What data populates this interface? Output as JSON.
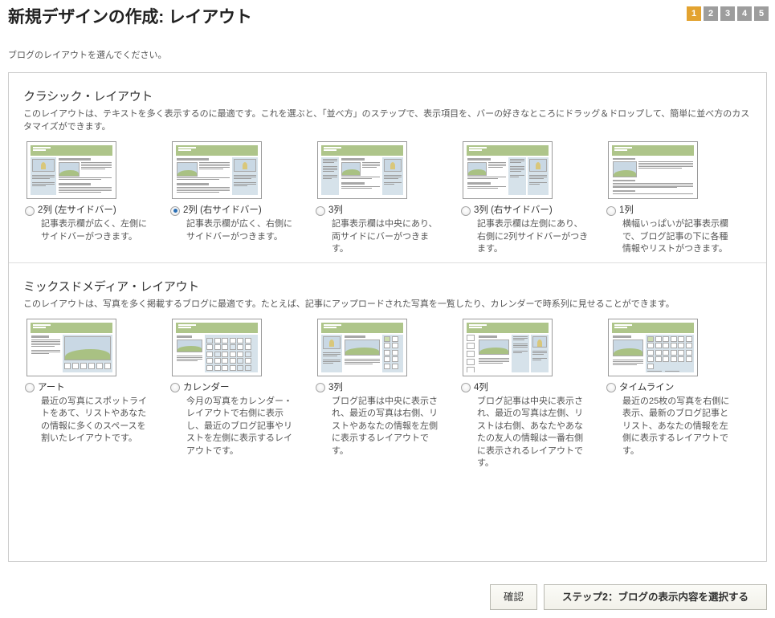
{
  "header": {
    "title": "新規デザインの作成: レイアウト",
    "subtitle": "ブログのレイアウトを選んでください。",
    "steps": [
      "1",
      "2",
      "3",
      "4",
      "5"
    ],
    "active_step": "1",
    "active_step_color": "#e3a330",
    "inactive_step_color": "#9d9d9d"
  },
  "sections": [
    {
      "title": "クラシック・レイアウト",
      "description": "このレイアウトは、テキストを多く表示するのに最適です。これを選ぶと、「並べ方」のステップで、表示項目を、バーの好きなところにドラッグ＆ドロップして、簡単に並べ方のカスタマイズができます。",
      "options": [
        {
          "label": "2列 (左サイドバー)",
          "description": "記事表示欄が広く、左側にサイドバーがつきます。",
          "selected": false,
          "thumb": "classic-left-sidebar"
        },
        {
          "label": "2列 (右サイドバー)",
          "description": "記事表示欄が広く、右側にサイドバーがつきます。",
          "selected": true,
          "thumb": "classic-right-sidebar"
        },
        {
          "label": "3列",
          "description": "記事表示欄は中央にあり、両サイドにバーがつきます。",
          "selected": false,
          "thumb": "classic-three-col"
        },
        {
          "label": "3列 (右サイドバー)",
          "description": "記事表示欄は左側にあり、右側に2列サイドバーがつきます。",
          "selected": false,
          "thumb": "classic-three-col-right"
        },
        {
          "label": "1列",
          "description": "横幅いっぱいが記事表示欄で、ブログ記事の下に各種情報やリストがつきます。",
          "selected": false,
          "thumb": "classic-one-col"
        }
      ]
    },
    {
      "title": "ミックスドメディア・レイアウト",
      "description": "このレイアウトは、写真を多く掲載するブログに最適です。たとえば、記事にアップロードされた写真を一覧したり、カレンダーで時系列に見せることができます。",
      "options": [
        {
          "label": "アート",
          "description": "最近の写真にスポットライトをあて、リストやあなたの情報に多くのスペースを割いたレイアウトです。",
          "selected": false,
          "thumb": "mixed-art"
        },
        {
          "label": "カレンダー",
          "description": "今月の写真をカレンダー・レイアウトで右側に表示し、最近のブログ記事やリストを左側に表示するレイアウトです。",
          "selected": false,
          "thumb": "mixed-calendar"
        },
        {
          "label": "3列",
          "description": "ブログ記事は中央に表示され、最近の写真は右側、リストやあなたの情報を左側に表示するレイアウトです。",
          "selected": false,
          "thumb": "mixed-three-col"
        },
        {
          "label": "4列",
          "description": "ブログ記事は中央に表示され、最近の写真は左側、リストは右側、あなたやあなたの友人の情報は一番右側に表示されるレイアウトです。",
          "selected": false,
          "thumb": "mixed-four-col"
        },
        {
          "label": "タイムライン",
          "description": "最近の25枚の写真を右側に表示、最新のブログ記事とリスト、あなたの情報を左側に表示するレイアウトです。",
          "selected": false,
          "thumb": "mixed-timeline"
        }
      ]
    }
  ],
  "footer": {
    "confirm_label": "確認",
    "next_label": "ステップ2：ブログの表示内容を選択する"
  },
  "colors": {
    "thumb_header_green": "#aec58a",
    "thumb_sidebar_blue": "#d6e2ea",
    "radio_selected": "#2b6fb5",
    "panel_border": "#cccccc"
  }
}
